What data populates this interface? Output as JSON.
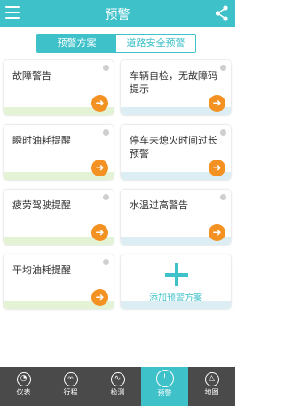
{
  "header": {
    "title": "预警"
  },
  "tabs": [
    {
      "label": "预警方案",
      "active": true
    },
    {
      "label": "道路安全预警",
      "active": false
    }
  ],
  "cards": [
    {
      "title": "故障警告",
      "band": "green"
    },
    {
      "title": "车辆自检，无故障码提示",
      "band": "blue"
    },
    {
      "title": "瞬时油耗提醒",
      "band": "green"
    },
    {
      "title": "停车未熄火时间过长预警",
      "band": "blue"
    },
    {
      "title": "疲劳驾驶提醒",
      "band": "green"
    },
    {
      "title": "水温过高警告",
      "band": "blue"
    },
    {
      "title": "平均油耗提醒",
      "band": "green"
    }
  ],
  "add_card": {
    "label": "添加预警方案"
  },
  "bottom_nav": [
    {
      "label": "仪表",
      "icon": "gauge-icon"
    },
    {
      "label": "行程",
      "icon": "route-icon"
    },
    {
      "label": "检测",
      "icon": "diagnose-icon"
    },
    {
      "label": "预警",
      "icon": "warning-icon",
      "active": true
    },
    {
      "label": "地图",
      "icon": "map-icon"
    }
  ],
  "colors": {
    "accent": "#3fc1c9",
    "arrow": "#f39222",
    "navbar": "#4a4a4a"
  }
}
